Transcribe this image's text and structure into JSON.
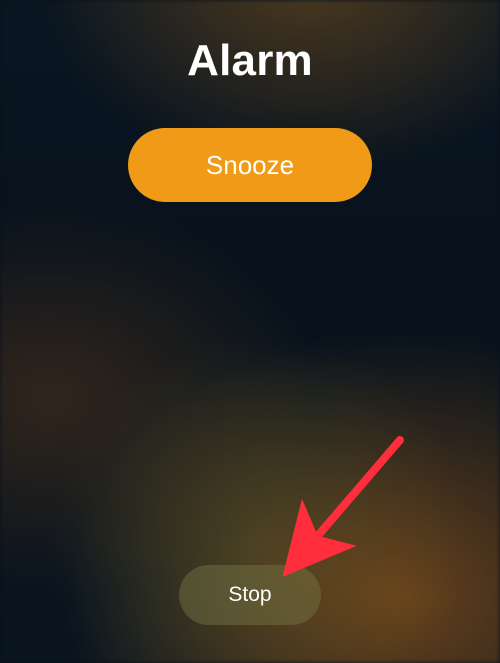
{
  "alarm": {
    "title": "Alarm",
    "snooze_label": "Snooze",
    "stop_label": "Stop"
  },
  "colors": {
    "accent": "#F09A17",
    "arrow": "#FF2E3C"
  }
}
